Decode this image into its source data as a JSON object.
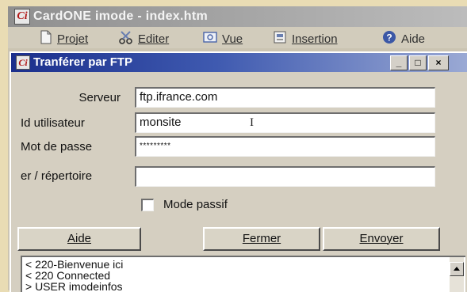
{
  "app": {
    "icon_glyph": "Ci",
    "title": "CardONE imode - index.htm"
  },
  "menubar": {
    "items": [
      {
        "label": "Projet",
        "icon": "document-icon"
      },
      {
        "label": "Editer",
        "icon": "scissors-icon"
      },
      {
        "label": "Vue",
        "icon": "view-icon"
      },
      {
        "label": "Insertion",
        "icon": "insert-icon"
      },
      {
        "label": "Aide",
        "icon": "help-icon"
      }
    ]
  },
  "dialog": {
    "icon_glyph": "Ci",
    "title": "Tranférer par FTP",
    "window_buttons": {
      "minimize": "_",
      "maximize": "□",
      "close": "×"
    },
    "fields": {
      "server": {
        "label": "Serveur",
        "value": "ftp.ifrance.com"
      },
      "user_id": {
        "label": "Id utilisateur",
        "value": "monsite"
      },
      "password": {
        "label": "Mot de passe",
        "value": "*********"
      },
      "directory": {
        "label": "er / répertoire",
        "value": ""
      }
    },
    "passive_mode": {
      "label": "Mode passif",
      "checked": false
    },
    "buttons": {
      "help": "Aide",
      "close": "Fermer",
      "send": "Envoyer"
    },
    "log": {
      "lines": [
        "< 220-Bienvenue ici",
        "< 220 Connected",
        "> USER imodeinfos"
      ]
    }
  },
  "colors": {
    "desktop_bg": "#e9dcb4",
    "dialog_title_start": "#1b2f8c",
    "dialog_title_end": "#9aa9d4",
    "app_title_bar": "#a7a7a7",
    "icon_red": "#b01515"
  }
}
